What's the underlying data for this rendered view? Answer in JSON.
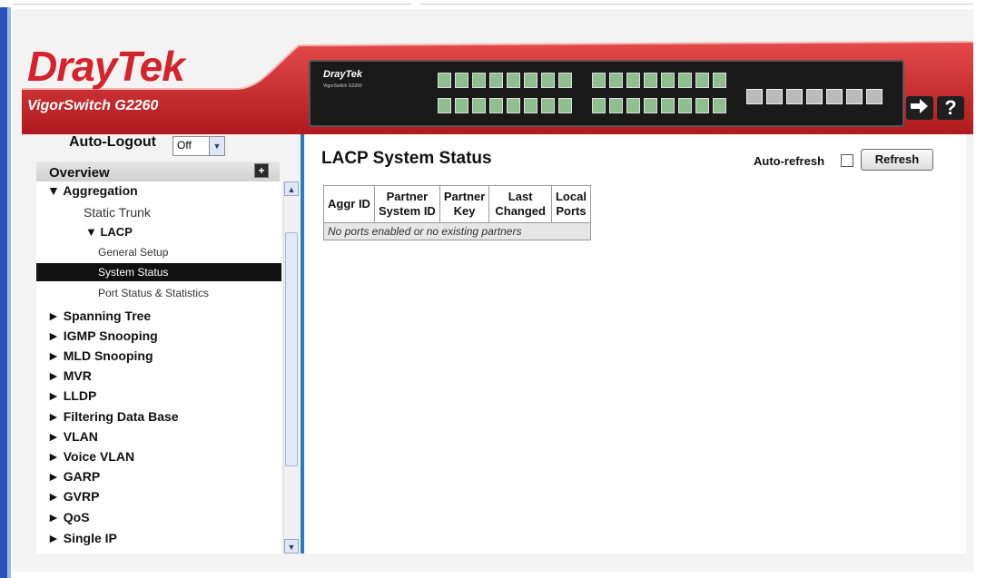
{
  "header": {
    "brand": "DrayTek",
    "model": "VigorSwitch G2260",
    "device_brand": "DrayTek",
    "device_model": "VigorSwitch G2260",
    "logout_icon": "exit-arrow-icon",
    "help_label": "?"
  },
  "auto_logout": {
    "label": "Auto-Logout",
    "value": "Off"
  },
  "menu": {
    "overview": "Overview",
    "items": [
      {
        "label": "▼ Aggregation",
        "level": 0
      },
      {
        "label": "Static Trunk",
        "level": 1
      },
      {
        "label": "▼ LACP",
        "level": 1
      },
      {
        "label": "General Setup",
        "level": 2
      },
      {
        "label": "System Status",
        "level": 2,
        "active": true
      },
      {
        "label": "Port Status & Statistics",
        "level": 2
      },
      {
        "label": "► Spanning Tree",
        "level": 0
      },
      {
        "label": "► IGMP Snooping",
        "level": 0
      },
      {
        "label": "► MLD Snooping",
        "level": 0
      },
      {
        "label": "► MVR",
        "level": 0
      },
      {
        "label": "► LLDP",
        "level": 0
      },
      {
        "label": "► Filtering Data Base",
        "level": 0
      },
      {
        "label": "► VLAN",
        "level": 0
      },
      {
        "label": "► Voice VLAN",
        "level": 0
      },
      {
        "label": "► GARP",
        "level": 0
      },
      {
        "label": "► GVRP",
        "level": 0
      },
      {
        "label": "► QoS",
        "level": 0
      },
      {
        "label": "► Single IP",
        "level": 0
      }
    ]
  },
  "page": {
    "title": "LACP System Status",
    "auto_refresh_label": "Auto-refresh",
    "refresh_label": "Refresh",
    "table": {
      "headers": [
        [
          "Aggr ID",
          ""
        ],
        [
          "Partner",
          "System ID"
        ],
        [
          "Partner",
          "Key"
        ],
        [
          "Last",
          "Changed"
        ],
        [
          "Local",
          "Ports"
        ]
      ],
      "empty_message": "No ports enabled or no existing partners"
    }
  }
}
